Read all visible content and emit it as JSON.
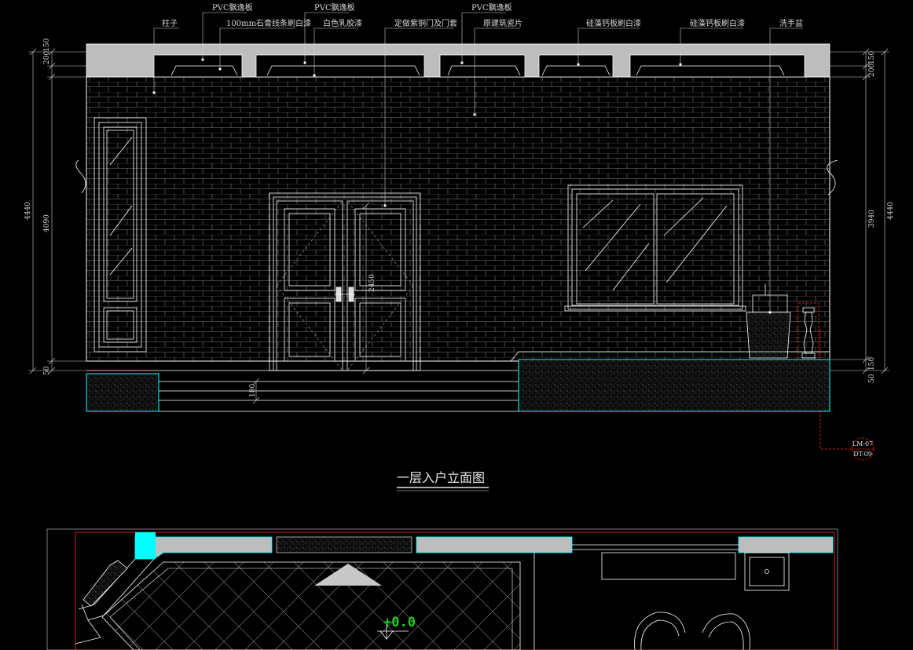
{
  "drawing": {
    "title": "一层入户立面图",
    "level_mark": "+0.0",
    "callouts": [
      "柱子",
      "PVC飘逸板",
      "100mm石膏线条刷白漆",
      "PVC飘逸板",
      "白色乳胶漆",
      "定做紫铜门及门套",
      "PVC飘逸板",
      "原建筑瓷片",
      "硅藻钙板刷白漆",
      "硅藻钙板刷白漆",
      "洗手盆"
    ],
    "dims_left": [
      "200",
      "150",
      "4440",
      "4090",
      "50"
    ],
    "dims_right": [
      "200",
      "150",
      "4440",
      "3940",
      "150",
      "50"
    ],
    "door_height": "2450",
    "step_height": "180",
    "detail_ref": {
      "top": "LM-07",
      "bottom": "DT-09"
    }
  },
  "colors": {
    "background": "#000000",
    "line": "#ffffff",
    "wall": "#bfbfbf",
    "cyan": "#00ffff",
    "red": "#ff2222",
    "green": "#22cc22"
  }
}
